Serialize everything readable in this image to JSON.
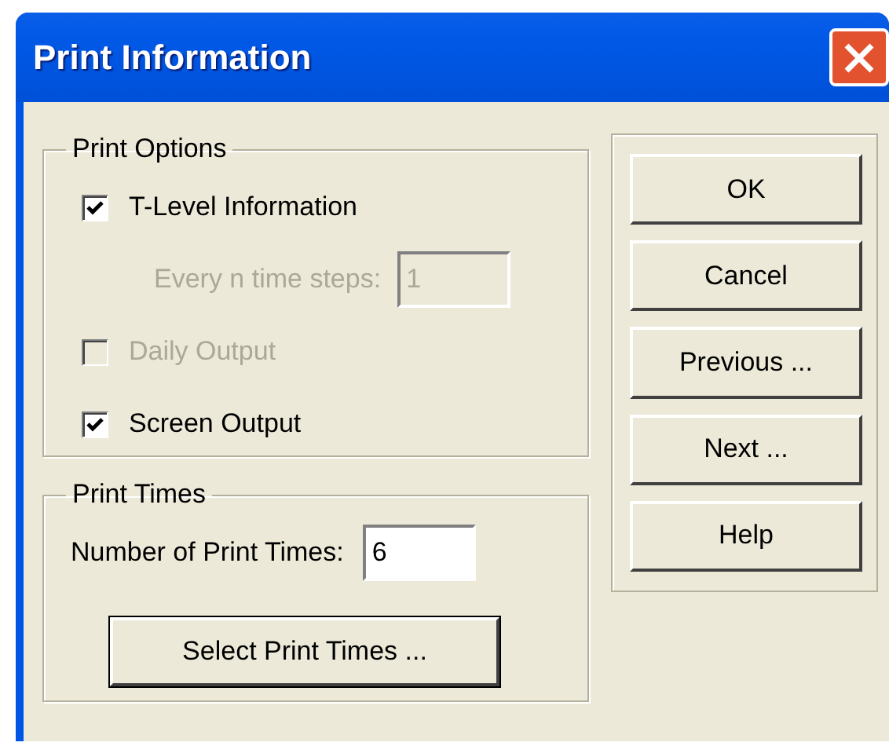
{
  "window": {
    "title": "Print Information"
  },
  "print_options": {
    "title": "Print Options",
    "items": [
      {
        "kind": "checkbox",
        "label": "T-Level Information",
        "checked": true,
        "disabled": false
      },
      {
        "kind": "field",
        "label": "Every n time steps:",
        "value": "1",
        "disabled": true
      },
      {
        "kind": "checkbox",
        "label": "Daily Output",
        "checked": false,
        "disabled": true
      },
      {
        "kind": "checkbox",
        "label": "Screen Output",
        "checked": true,
        "disabled": false
      }
    ]
  },
  "print_times": {
    "title": "Print Times",
    "field": {
      "label": "Number of Print Times:",
      "value": "6"
    },
    "button": "Select Print Times ..."
  },
  "buttons": [
    "OK",
    "Cancel",
    "Previous ...",
    "Next ...",
    "Help"
  ]
}
